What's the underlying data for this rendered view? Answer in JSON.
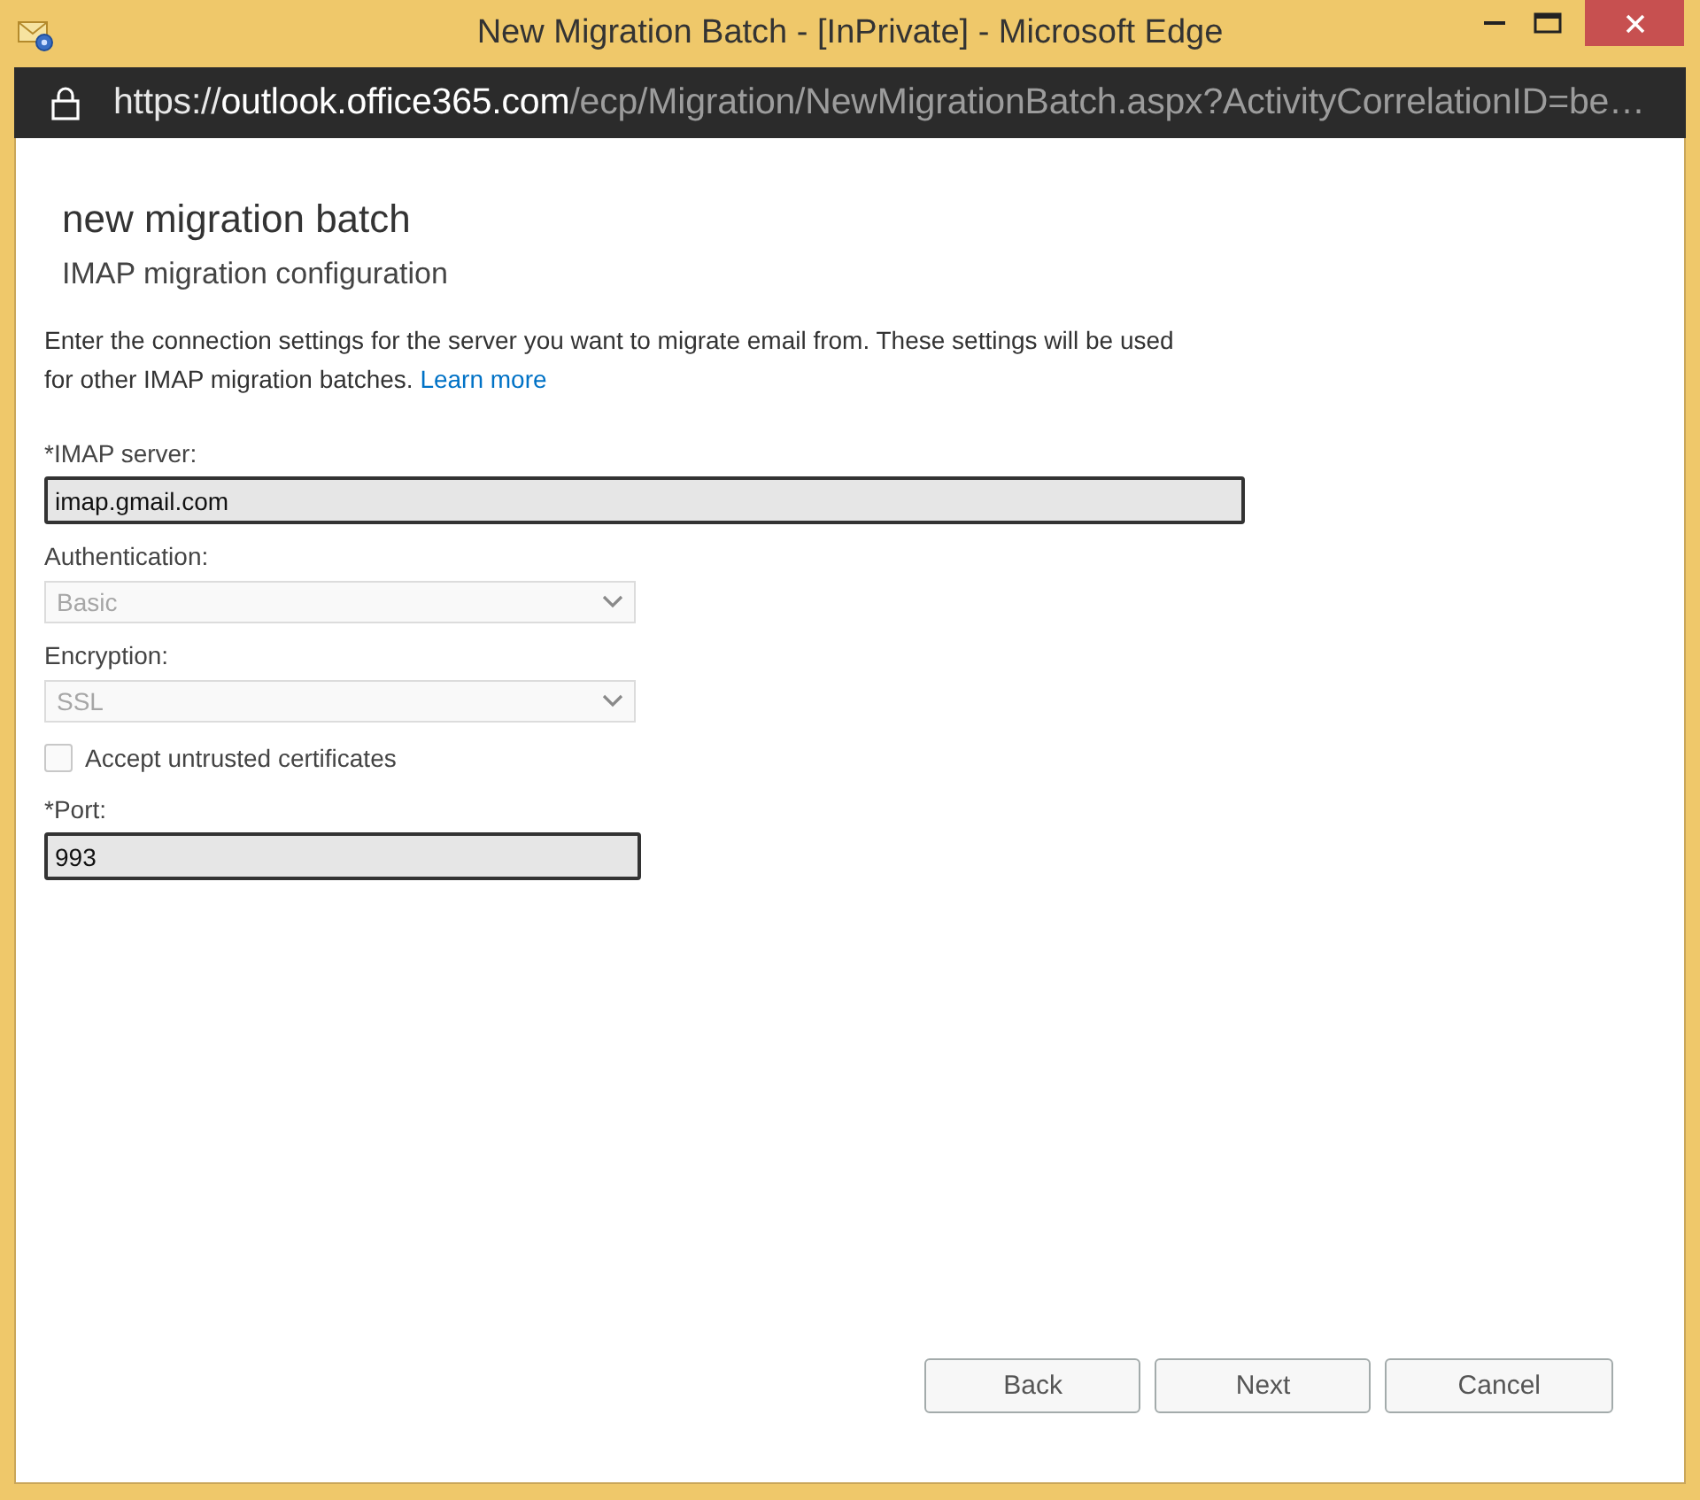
{
  "window": {
    "title": "New Migration Batch - [InPrivate] - Microsoft Edge"
  },
  "address_bar": {
    "url": {
      "scheme": "https://",
      "host": "outlook.office365.com",
      "path": "/ecp/Migration/NewMigrationBatch.aspx?ActivityCorrelationID=be…"
    }
  },
  "page": {
    "title": "new migration batch",
    "subtitle": "IMAP migration configuration",
    "intro": "Enter the connection settings for the server you want to migrate email from. These settings will be used for other IMAP migration batches.",
    "intro_link": "Learn more"
  },
  "form": {
    "imap_server": {
      "label": "*IMAP server:",
      "value": "imap.gmail.com"
    },
    "authentication": {
      "label": "Authentication:",
      "value": "Basic",
      "disabled": true
    },
    "encryption": {
      "label": "Encryption:",
      "value": "SSL",
      "disabled": true
    },
    "accept_untrusted_certificates": {
      "label": "Accept untrusted certificates",
      "checked": false
    },
    "port": {
      "label": "*Port:",
      "value": "993"
    }
  },
  "buttons": [
    "Back",
    "Next",
    "Cancel"
  ]
}
